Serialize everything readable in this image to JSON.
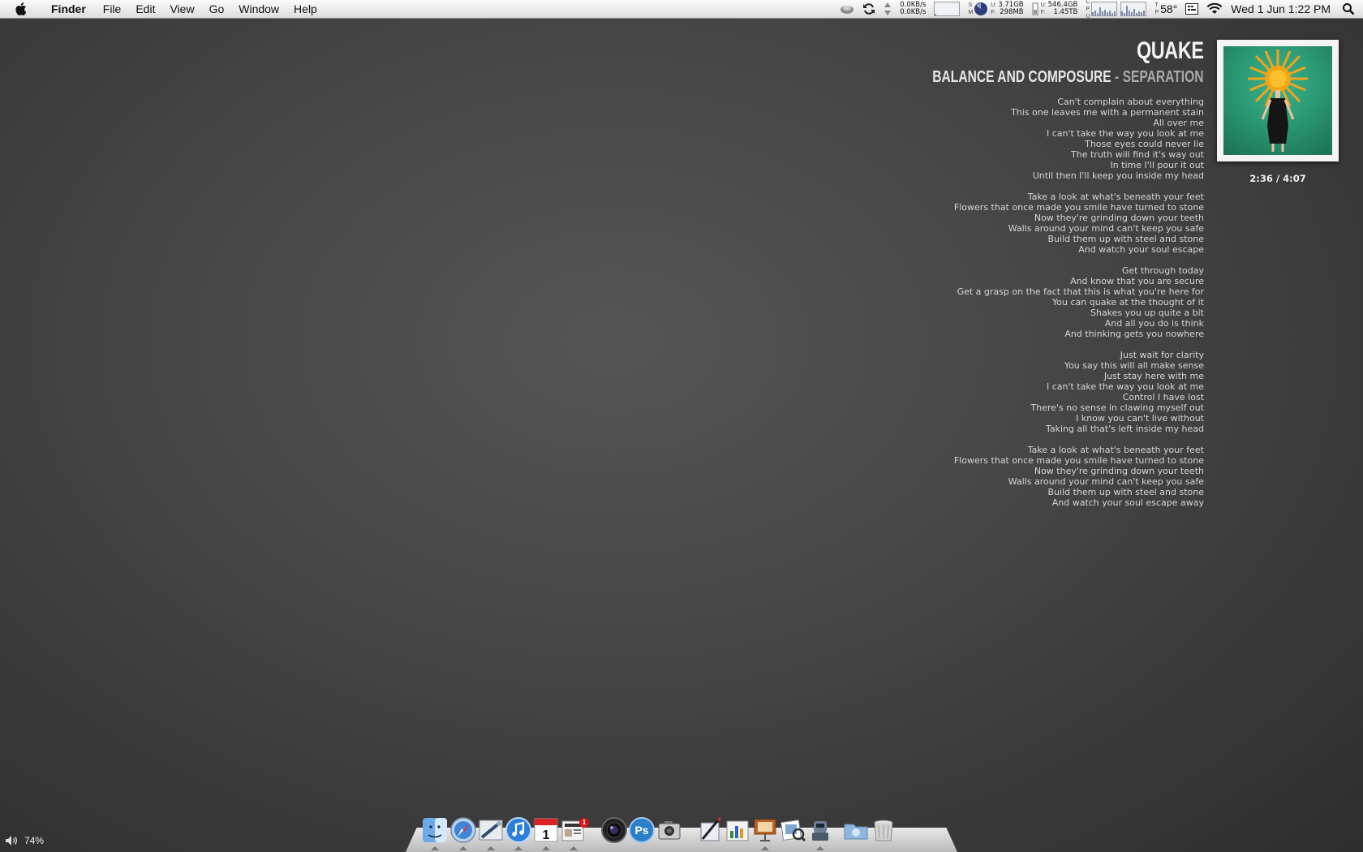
{
  "menubar": {
    "app_name": "Finder",
    "items": [
      "File",
      "Edit",
      "View",
      "Go",
      "Window",
      "Help"
    ],
    "net_up": "0.0KB/s",
    "net_down": "0.0KB/s",
    "mem_used_label": "U:",
    "mem_free_label": "F:",
    "mem_used": "3.71GB",
    "mem_free": "298MB",
    "disk_used_label": "U:",
    "disk_free_label": "F:",
    "disk_used": "546.4GB",
    "disk_free": "1.45TB",
    "mem_used_fraction": 0.85,
    "temperature": "58°",
    "datetime": "Wed 1 Jun  1:22 PM"
  },
  "now_playing": {
    "song": "QUAKE",
    "artist": "BALANCE AND COMPOSURE",
    "separator": " - ",
    "album": "SEPARATION",
    "elapsed": "2:36",
    "total": "4:07",
    "time_separator": " / ",
    "lyrics": [
      [
        "Can't complain about everything",
        "This one leaves me with a permanent stain",
        "All over me",
        "I can't take the way you look at me",
        "Those eyes could never lie",
        "The truth will find it's way out",
        "In time I'll pour it out",
        "Until then I'll keep you inside my head"
      ],
      [
        "Take a look at what's beneath your feet",
        "Flowers that once made you smile have turned to stone",
        "Now they're grinding down your teeth",
        "Walls around your mind can't keep you safe",
        "Build them up with steel and stone",
        "And watch your soul escape"
      ],
      [
        "Get through today",
        "And know that you are secure",
        "Get a grasp on the fact that this is what you're here for",
        "You can quake at the thought of it",
        "Shakes you up quite a bit",
        "And all you do is think",
        "And thinking gets you nowhere"
      ],
      [
        "Just wait for clarity",
        "You say this will all make sense",
        "Just stay here with me",
        "I can't take the way you look at me",
        "Control I have lost",
        "There's no sense in clawing myself out",
        "I know you can't live without",
        "Taking all that's left inside my head"
      ],
      [
        "Take a look at what's beneath your feet",
        "Flowers that once made you smile have turned to stone",
        "Now they're grinding down your teeth",
        "Walls around your mind can't keep you safe",
        "Build them up with steel and stone",
        "And watch your soul escape away"
      ]
    ]
  },
  "dock": {
    "badge_count": "1",
    "calendar_day": "1",
    "photoshop_label": "Ps",
    "icons": [
      "finder-icon",
      "safari-icon",
      "mail-icon",
      "itunes-icon",
      "ical-icon",
      "newsreader-icon",
      "aperture-icon",
      "photoshop-icon",
      "image-capture-icon",
      "script-editor-icon",
      "numbers-icon",
      "keynote-icon",
      "preview-icon",
      "automator-icon",
      "downloads-folder-icon",
      "trash-icon"
    ]
  },
  "volume": {
    "level": "74%",
    "fraction": 0.74
  }
}
